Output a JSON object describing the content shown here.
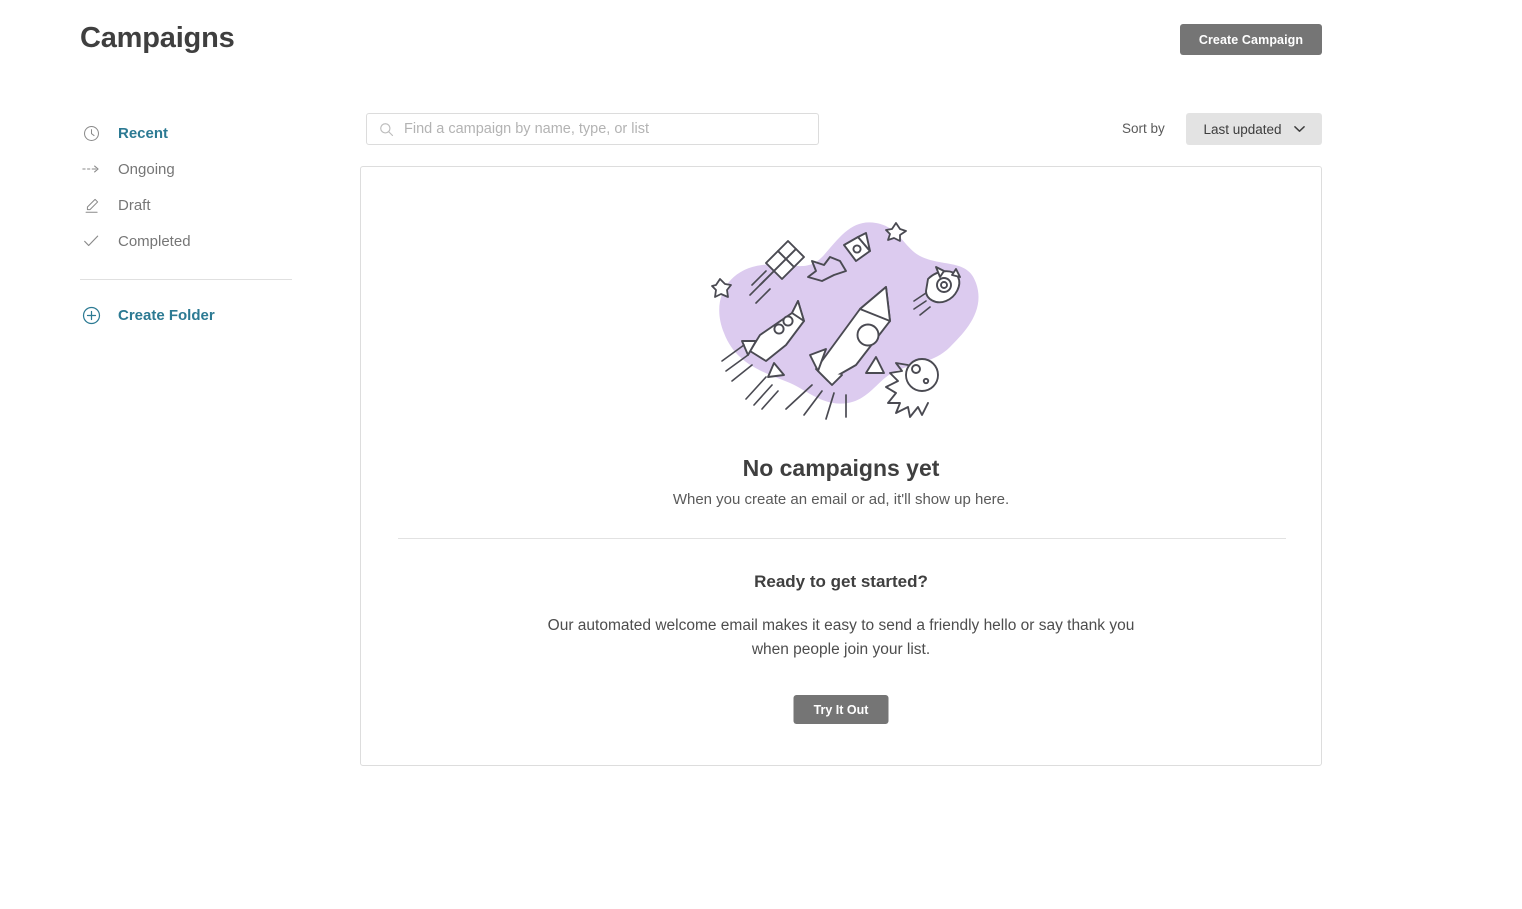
{
  "header": {
    "title": "Campaigns",
    "create_campaign_label": "Create Campaign"
  },
  "sidebar": {
    "items": [
      {
        "label": "Recent",
        "icon": "clock-icon",
        "active": true
      },
      {
        "label": "Ongoing",
        "icon": "arrow-dashed-icon",
        "active": false
      },
      {
        "label": "Draft",
        "icon": "pencil-icon",
        "active": false
      },
      {
        "label": "Completed",
        "icon": "check-icon",
        "active": false
      }
    ],
    "create_folder": {
      "label": "Create Folder",
      "icon": "plus-circle-icon"
    }
  },
  "toolbar": {
    "search_placeholder": "Find a campaign by name, type, or list",
    "search_value": "",
    "search_icon": "search-icon",
    "sort_by_label": "Sort by",
    "sort_value": "Last updated",
    "sort_chevron": "chevron-down-icon"
  },
  "main": {
    "illustration": "rockets-space-illustration",
    "empty_title": "No campaigns yet",
    "empty_subtitle": "When you create an email or ad, it'll show up here.",
    "cta_title": "Ready to get started?",
    "cta_body": "Our automated welcome email makes it easy to send a friendly hello or say thank you when people join your list.",
    "cta_button_label": "Try It Out"
  },
  "colors": {
    "accent_teal": "#2c7a93",
    "button_gray": "#757575",
    "illustration_purple": "#DCCBEF",
    "line_art": "#4a4a52",
    "border": "#dddddd"
  }
}
